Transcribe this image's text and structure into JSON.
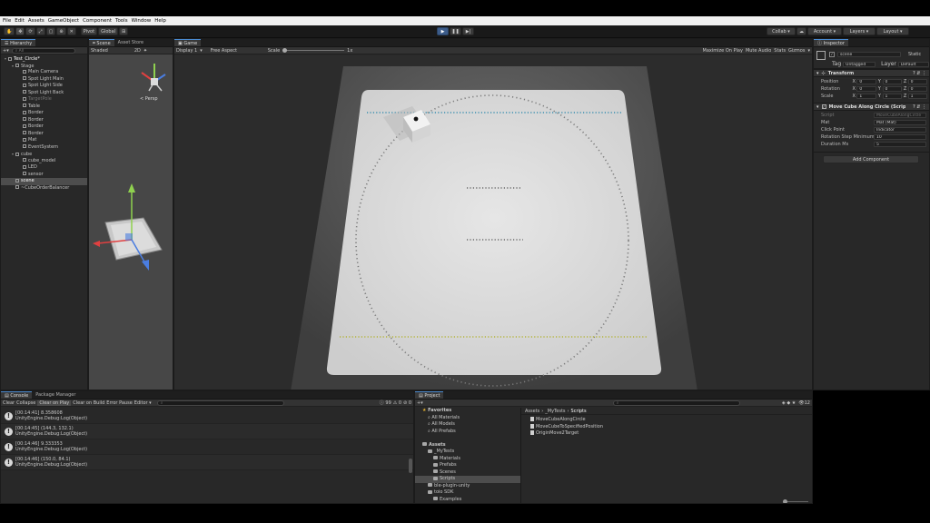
{
  "menu": [
    "File",
    "Edit",
    "Assets",
    "GameObject",
    "Component",
    "Tools",
    "Window",
    "Help"
  ],
  "toolbar": {
    "pivot": "Pivot",
    "global": "Global",
    "collab": "Collab ▾",
    "account": "Account",
    "layers": "Layers",
    "layout": "Layout"
  },
  "hierarchy": {
    "tab": "Hierarchy",
    "search": "All",
    "items": [
      {
        "label": "Test_Circle*",
        "depth": 0,
        "fold": true,
        "style": "root"
      },
      {
        "label": "Stage",
        "depth": 1,
        "fold": true,
        "style": ""
      },
      {
        "label": "Main Camera",
        "depth": 2,
        "fold": false,
        "style": ""
      },
      {
        "label": "Spot Light Main",
        "depth": 2,
        "fold": false,
        "style": ""
      },
      {
        "label": "Spot Light Side",
        "depth": 2,
        "fold": false,
        "style": ""
      },
      {
        "label": "Spot Light Back",
        "depth": 2,
        "fold": false,
        "style": ""
      },
      {
        "label": "TargetPole",
        "depth": 2,
        "fold": false,
        "style": "dim"
      },
      {
        "label": "Table",
        "depth": 2,
        "fold": false,
        "style": ""
      },
      {
        "label": "Border",
        "depth": 2,
        "fold": false,
        "style": ""
      },
      {
        "label": "Border",
        "depth": 2,
        "fold": false,
        "style": ""
      },
      {
        "label": "Border",
        "depth": 2,
        "fold": false,
        "style": ""
      },
      {
        "label": "Border",
        "depth": 2,
        "fold": false,
        "style": ""
      },
      {
        "label": "Mat",
        "depth": 2,
        "fold": false,
        "style": ""
      },
      {
        "label": "EventSystem",
        "depth": 2,
        "fold": false,
        "style": ""
      },
      {
        "label": "cube",
        "depth": 1,
        "fold": true,
        "style": ""
      },
      {
        "label": "cube_model",
        "depth": 2,
        "fold": false,
        "style": ""
      },
      {
        "label": "LED",
        "depth": 2,
        "fold": false,
        "style": ""
      },
      {
        "label": "sensor",
        "depth": 2,
        "fold": false,
        "style": ""
      },
      {
        "label": "scene",
        "depth": 1,
        "fold": false,
        "style": "sel"
      },
      {
        "label": "~CubeOrderBalancer",
        "depth": 1,
        "fold": false,
        "style": ""
      }
    ]
  },
  "scene": {
    "tabs": [
      "Scene",
      "Asset Store"
    ],
    "shading": "Shaded",
    "mode": "2D",
    "persp": "< Persp"
  },
  "game": {
    "tab": "Game",
    "display": "Display 1",
    "aspect": "Free Aspect",
    "scale_label": "Scale",
    "scale_value": "1x",
    "options": [
      "Maximize On Play",
      "Mute Audio",
      "Stats",
      "Gizmos"
    ]
  },
  "inspector": {
    "tab": "Inspector",
    "name": "scene",
    "static": "Static",
    "tag_label": "Tag",
    "tag": "Untagged",
    "layer_label": "Layer",
    "layer": "Default",
    "transform": {
      "title": "Transform",
      "rows": [
        {
          "label": "Position",
          "x": "0",
          "y": "0",
          "z": "0"
        },
        {
          "label": "Rotation",
          "x": "0",
          "y": "0",
          "z": "0"
        },
        {
          "label": "Scale",
          "x": "1",
          "y": "1",
          "z": "1"
        }
      ]
    },
    "script_component": {
      "title": "Move Cube Along Circle (Script)",
      "rows": [
        {
          "label": "Script",
          "value": "MoveCubeAlongCircle",
          "dim": true
        },
        {
          "label": "Mat",
          "value": "Mat (Mat)",
          "dim": false
        },
        {
          "label": "Click Point",
          "value": "Indicator",
          "dim": false
        },
        {
          "label": "Rotation Step Minimum",
          "value": "10",
          "dim": false
        },
        {
          "label": "Duration Ms",
          "value": "5",
          "dim": false
        }
      ]
    },
    "add_component": "Add Component"
  },
  "console": {
    "tabs": [
      "Console",
      "Package Manager"
    ],
    "buttons": [
      "Clear",
      "Collapse",
      "Clear on Play",
      "Clear on Build",
      "Error Pause",
      "Editor ▾"
    ],
    "counts": {
      "log": "99",
      "warn": "0",
      "error": "0"
    },
    "rows": [
      {
        "line1": "[00:14:41] 8.358608",
        "line2": "UnityEngine.Debug:Log(Object)"
      },
      {
        "line1": "[00:14:45] (144.3, 132.1)",
        "line2": "UnityEngine.Debug:Log(Object)"
      },
      {
        "line1": "[00:14:46] 9.333353",
        "line2": "UnityEngine.Debug:Log(Object)"
      },
      {
        "line1": "[00:14:46] (150.0, 84.1)",
        "line2": "UnityEngine.Debug:Log(Object)"
      }
    ]
  },
  "project": {
    "tab": "Project",
    "count": "12",
    "tree": [
      {
        "label": "Favorites",
        "depth": 0,
        "type": "star"
      },
      {
        "label": "All Materials",
        "depth": 1,
        "type": "search"
      },
      {
        "label": "All Models",
        "depth": 1,
        "type": "search"
      },
      {
        "label": "All Prefabs",
        "depth": 1,
        "type": "search"
      },
      {
        "label": "",
        "depth": 0,
        "type": "gap"
      },
      {
        "label": "Assets",
        "depth": 0,
        "type": "folder"
      },
      {
        "label": "_MyTests",
        "depth": 1,
        "type": "folder"
      },
      {
        "label": "Materials",
        "depth": 2,
        "type": "folder"
      },
      {
        "label": "Prefabs",
        "depth": 2,
        "type": "folder"
      },
      {
        "label": "Scenes",
        "depth": 2,
        "type": "folder"
      },
      {
        "label": "Scripts",
        "depth": 2,
        "type": "folder-sel"
      },
      {
        "label": "ble-plugin-unity",
        "depth": 1,
        "type": "folder"
      },
      {
        "label": "toio SDK",
        "depth": 1,
        "type": "folder"
      },
      {
        "label": "Examples",
        "depth": 2,
        "type": "folder"
      },
      {
        "label": "00.ToioCubeBasics",
        "depth": 3,
        "type": "folder"
      }
    ],
    "breadcrumb": [
      "Assets",
      "_MyTests",
      "Scripts"
    ],
    "files": [
      "MoveCubeAlongCircle",
      "MoveCubeToSpecifiedPosition",
      "OriginMove2Target"
    ]
  }
}
